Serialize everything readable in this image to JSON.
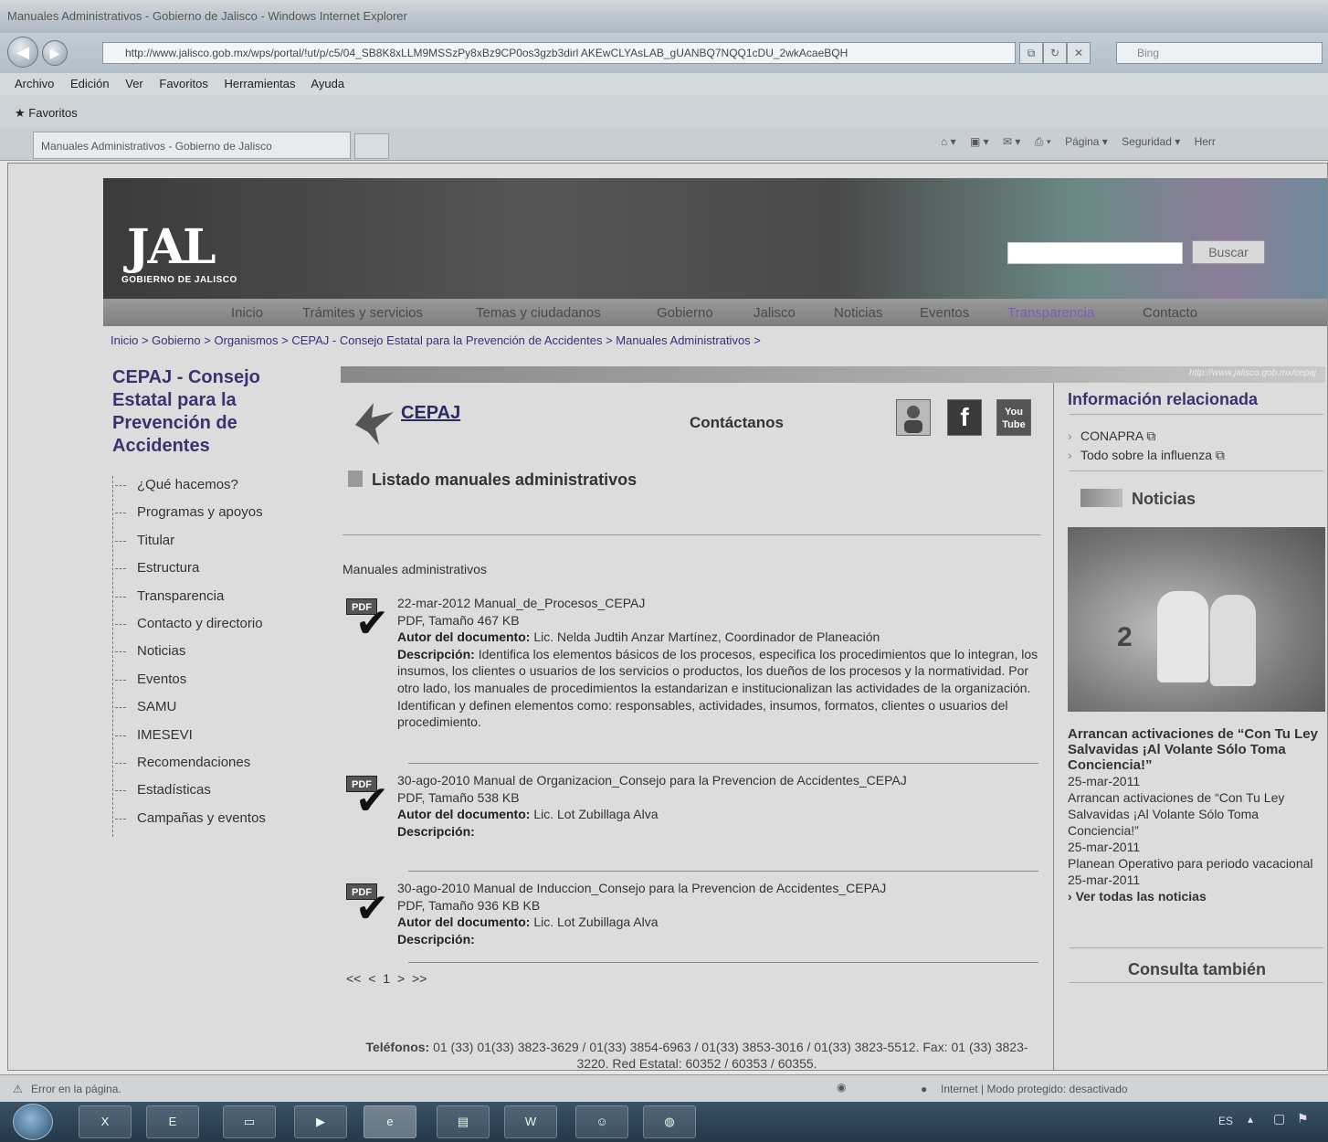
{
  "browser": {
    "window_title": "Manuales Administrativos - Gobierno de Jalisco - Windows Internet Explorer",
    "address": "http://www.jalisco.gob.mx/wps/portal/!ut/p/c5/04_SB8K8xLLM9MSSzPy8xBz9CP0os3gzb3dirl AKEwCLYAsLAB_gUANBQ7NQQ1cDU_2wkAcaeBQH",
    "search_placeholder": "Bing",
    "menu": [
      "Archivo",
      "Edición",
      "Ver",
      "Favoritos",
      "Herramientas",
      "Ayuda"
    ],
    "favorites_label": "Favoritos",
    "tab_title": "Manuales Administrativos - Gobierno de Jalisco",
    "commands": [
      "Página ▾",
      "Seguridad ▾",
      "Herr"
    ],
    "status_left": "Error en la página.",
    "status_right": "Internet | Modo protegido: desactivado",
    "lang": "ES"
  },
  "header": {
    "logo_text": "JAL",
    "logo_sub": "GOBIERNO DE JALISCO",
    "search_button": "Buscar",
    "nav": [
      "Inicio",
      "Trámites y servicios",
      "Temas y ciudadanos",
      "Gobierno",
      "Jalisco",
      "Noticias",
      "Eventos",
      "Transparencia",
      "Contacto"
    ]
  },
  "breadcrumb": "Inicio > Gobierno > Organismos > CEPAJ - Consejo Estatal para la Prevención de Accidentes > Manuales Administrativos >",
  "sidebar": {
    "title": "CEPAJ - Consejo Estatal para la Prevención de Accidentes",
    "items": [
      "¿Qué hacemos?",
      "Programas y apoyos",
      "Titular",
      "Estructura",
      "Transparencia",
      "Contacto y directorio",
      "Noticias",
      "Eventos",
      "SAMU",
      "IMESEVI",
      "Recomendaciones",
      "Estadísticas",
      "Campañas y eventos"
    ]
  },
  "url_strip": "http://www.jalisco.gob.mx/cepaj",
  "main": {
    "cepaj_logo": "CEPAJ",
    "contact": "Contáctanos",
    "social": [
      "f",
      "You Tube"
    ],
    "section_title": "Listado manuales administrativos",
    "list_label": "Manuales administrativos",
    "pdf_tag": "PDF",
    "author_label": "Autor del documento:",
    "desc_label": "Descripción:",
    "documents": [
      {
        "title": "22-mar-2012 Manual_de_Procesos_CEPAJ",
        "size": "PDF, Tamaño 467 KB",
        "author": "Lic. Nelda Judtih Anzar Martínez, Coordinador de Planeación",
        "description": "Identifica los elementos básicos de los procesos, especifica los procedimientos que lo integran, los insumos, los clientes o usuarios de los servicios o productos, los dueños de los procesos y la normatividad. Por otro lado, los manuales de procedimientos la estandarizan e institucionalizan las actividades de la organización. Identifican y definen elementos como: responsables, actividades, insumos, formatos, clientes o usuarios del procedimiento."
      },
      {
        "title": "30-ago-2010 Manual de Organizacion_Consejo para la Prevencion de Accidentes_CEPAJ",
        "size": "PDF, Tamaño 538 KB",
        "author": "Lic. Lot Zubillaga Alva",
        "description": ""
      },
      {
        "title": "30-ago-2010 Manual de Induccion_Consejo para la Prevencion de Accidentes_CEPAJ",
        "size": "PDF, Tamaño 936 KB KB",
        "author": "Lic. Lot Zubillaga Alva",
        "description": ""
      }
    ],
    "pager": "<< < 1 > >>",
    "footer_label": "Teléfonos:",
    "footer_text": "01 (33) 01(33) 3823-3629 / 01(33) 3854-6963 / 01(33) 3853-3016 / 01(33) 3823-5512. Fax: 01 (33) 3823-3220. Red Estatal: 60352 / 60353 / 60355."
  },
  "right": {
    "info_title": "Información relacionada",
    "links": [
      "CONAPRA ⧉",
      "Todo sobre la influenza ⧉"
    ],
    "news_title": "Noticias",
    "photo_number": "2",
    "news_headline": "Arrancan activaciones de “Con Tu Ley Salvavidas ¡Al Volante Sólo Toma Conciencia!”",
    "news_items": [
      {
        "date": "25-mar-2011",
        "text": "Arrancan activaciones de “Con Tu Ley Salvavidas ¡Al Volante Sólo Toma Conciencia!”"
      },
      {
        "date": "25-mar-2011",
        "text": "Planean Operativo para periodo vacacional"
      },
      {
        "date": "25-mar-2011",
        "text": ""
      }
    ],
    "see_all": "Ver todas las noticias",
    "consulta": "Consulta también"
  }
}
